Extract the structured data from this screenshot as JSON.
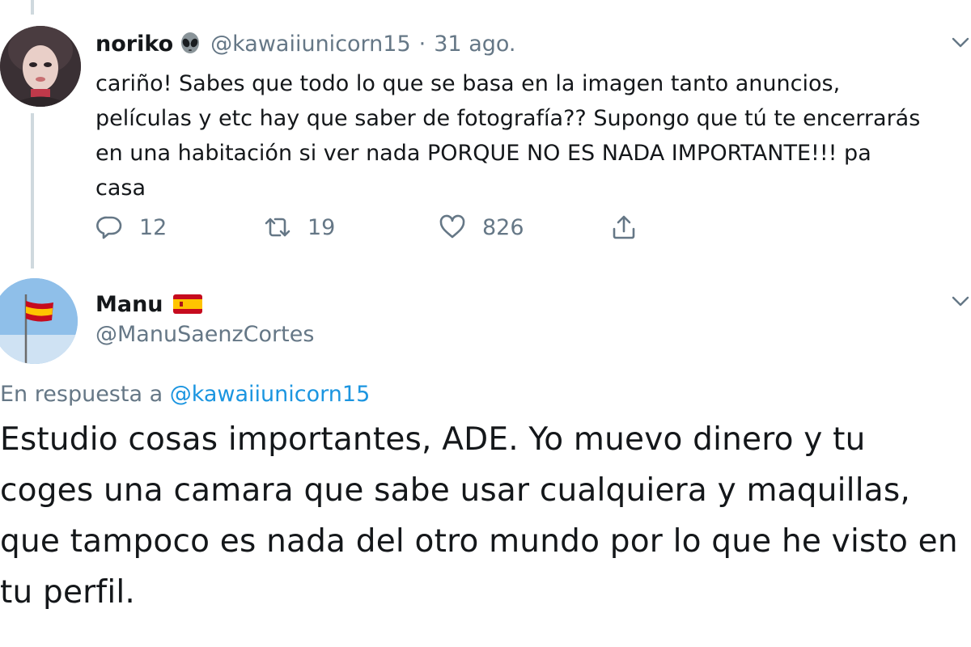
{
  "tweet1": {
    "author_name": "noriko",
    "author_emoji_icon": "alien-icon",
    "handle": "@kawaiiunicorn15",
    "separator": "·",
    "date": "31 ago.",
    "body": "cariño! Sabes que todo lo que se basa en la imagen tanto anuncios, películas y etc hay que saber de fotografía?? Supongo que tú te encerrarás en una habitación si ver nada PORQUE NO ES NADA IMPORTANTE!!! pa casa",
    "actions": {
      "reply_count": "12",
      "retweet_count": "19",
      "like_count": "826"
    }
  },
  "tweet2": {
    "author_name": "Manu",
    "author_flag_icon": "spain-flag-icon",
    "handle": "@ManuSaenzCortes",
    "reply_prefix": "En respuesta a ",
    "reply_mention": "@kawaiiunicorn15",
    "body": "Estudio cosas importantes, ADE. Yo muevo dinero y tu coges una camara que sabe usar cualquiera y maquillas, que tampoco es nada del otro mundo por lo que he visto en tu perfil."
  },
  "colors": {
    "text_primary": "#14171a",
    "text_secondary": "#657786",
    "link": "#1b95e0",
    "thread_line": "#cfd9de"
  }
}
